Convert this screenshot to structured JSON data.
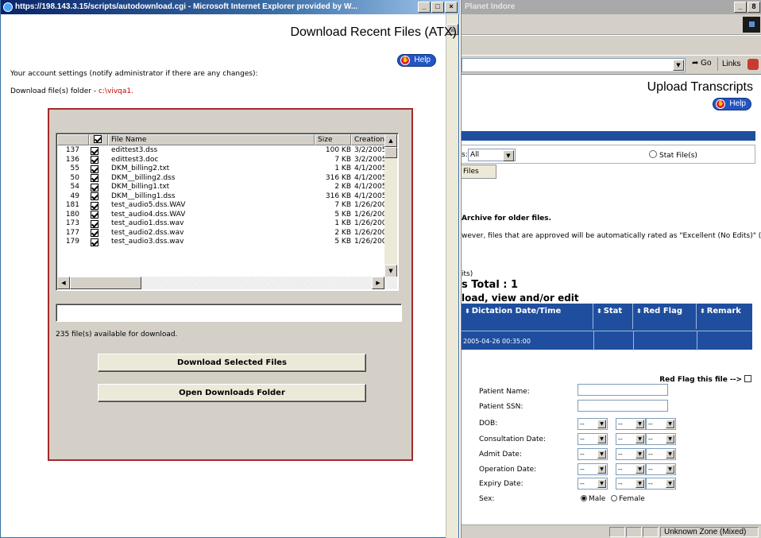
{
  "background_window": {
    "title": "Planet Indore",
    "min_label": "_",
    "max_label": "8",
    "go_label": "Go",
    "links_label": "Links",
    "page_title": "Upload Transcripts",
    "help_label": "Help",
    "filter_prefix": "s:",
    "filter_value": "All",
    "stat_files_label": "Stat File(s)",
    "files_tab": "Files",
    "archive_text": "Archive for older files.",
    "however_text": "wever, files that are approved will be automatically rated as \"Excellent (No Edits)\" (no",
    "its_text": "its)",
    "total_text": "s Total : 1",
    "upload_view_text": "load, view and/or edit",
    "table_headers": [
      "Dictation Date/Time",
      "Stat",
      "Red Flag",
      "Remark"
    ],
    "table_row_date": "2005-04-26 00:35:00",
    "red_flag_label": "Red Flag this file -->",
    "form": {
      "patient_name": "Patient Name:",
      "patient_ssn": "Patient SSN:",
      "dob": "DOB:",
      "consultation_date": "Consultation Date:",
      "admit_date": "Admit Date:",
      "operation_date": "Operation Date:",
      "expiry_date": "Expiry Date:",
      "sex": "Sex:",
      "male": "Male",
      "female": "Female",
      "select_default": "--"
    },
    "zone": "Unknown Zone (Mixed)"
  },
  "popup": {
    "title": "https://198.143.3.15/scripts/autodownload.cgi - Microsoft Internet Explorer provided by W...",
    "page_title": "Download Recent Files (ATX)",
    "help_label": "Help",
    "account_text": "Your account settings (notify administrator if there are any changes):",
    "folder_label": "Download file(s) folder - ",
    "folder_path": "c:\\vivqa1.",
    "columns": [
      "File Name",
      "Size",
      "Creation D"
    ],
    "files": [
      {
        "num": "137",
        "name": "edittest3.dss",
        "size": "100 KB",
        "date": "3/2/2005"
      },
      {
        "num": "136",
        "name": "edittest3.doc",
        "size": "7 KB",
        "date": "3/2/2005"
      },
      {
        "num": "55",
        "name": "DKM_billing2.txt",
        "size": "1 KB",
        "date": "4/1/2005"
      },
      {
        "num": "50",
        "name": "DKM__billing2.dss",
        "size": "316 KB",
        "date": "4/1/2005"
      },
      {
        "num": "54",
        "name": "DKM_billing1.txt",
        "size": "2 KB",
        "date": "4/1/2005"
      },
      {
        "num": "49",
        "name": "DKM__billing1.dss",
        "size": "316 KB",
        "date": "4/1/2005"
      },
      {
        "num": "181",
        "name": "test_audio5.dss.WAV",
        "size": "7 KB",
        "date": "1/26/2005"
      },
      {
        "num": "180",
        "name": "test_audio4.dss.WAV",
        "size": "5 KB",
        "date": "1/26/2005"
      },
      {
        "num": "173",
        "name": "test_audio1.dss.wav",
        "size": "1 KB",
        "date": "1/26/2005"
      },
      {
        "num": "177",
        "name": "test_audio2.dss.wav",
        "size": "2 KB",
        "date": "1/26/2005"
      },
      {
        "num": "179",
        "name": "test_audio3.dss.wav",
        "size": "5 KB",
        "date": "1/26/2005"
      }
    ],
    "available_text": "235 file(s) available for download.",
    "download_button": "Download Selected Files",
    "open_button": "Open Downloads Folder"
  },
  "colors": {
    "panel_border": "#a52a2a",
    "folder_path": "#cc0000",
    "table_header_blue": "#1f4e9e",
    "help_blue": "#2255c4"
  }
}
